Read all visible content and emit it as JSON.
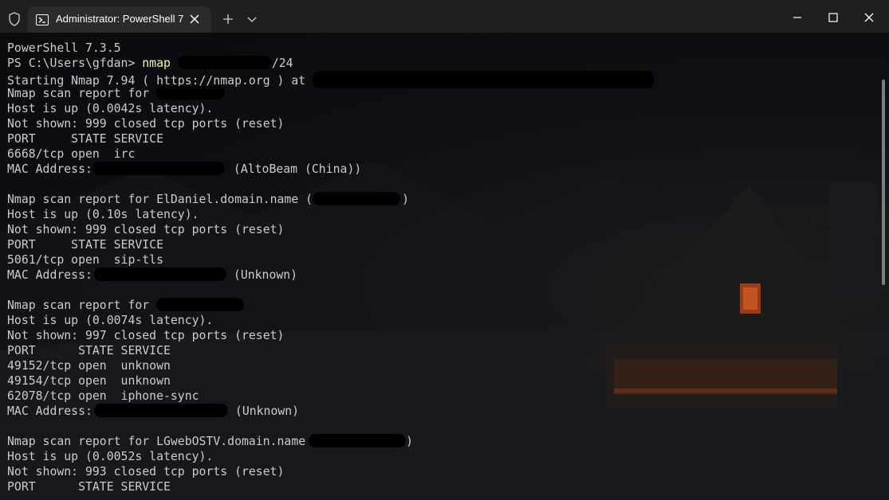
{
  "window": {
    "tab_title": "Administrator: PowerShell 7",
    "colors": {
      "titlebar": "#1f1f1f",
      "tab": "#2b2b2b",
      "text": "#cccccc",
      "command": "#f9f1a5"
    }
  },
  "terminal": {
    "l01": "PowerShell 7.3.5",
    "l02_prompt": "PS C:\\Users\\gfdan> ",
    "l02_cmd": "nmap",
    "l02_suffix": "/24",
    "l03": "Starting Nmap 7.94 ( https://nmap.org ) at",
    "l04": "Nmap scan report for",
    "l05": "Host is up (0.0042s latency).",
    "l06": "Not shown: 999 closed tcp ports (reset)",
    "l07": "PORT     STATE SERVICE",
    "l08": "6668/tcp open  irc",
    "l09a": "MAC Address:",
    "l09b": "(AltoBeam (China))",
    "l11a": "Nmap scan report for ElDaniel.domain.name (",
    "l11b": ")",
    "l12": "Host is up (0.10s latency).",
    "l13": "Not shown: 999 closed tcp ports (reset)",
    "l14": "PORT     STATE SERVICE",
    "l15": "5061/tcp open  sip-tls",
    "l16a": "MAC Address:",
    "l16b": "(Unknown)",
    "l18": "Nmap scan report for",
    "l19": "Host is up (0.0074s latency).",
    "l20": "Not shown: 997 closed tcp ports (reset)",
    "l21": "PORT      STATE SERVICE",
    "l22": "49152/tcp open  unknown",
    "l23": "49154/tcp open  unknown",
    "l24": "62078/tcp open  iphone-sync",
    "l25a": "MAC Address:",
    "l25b": "(Unknown)",
    "l27a": "Nmap scan report for LGwebOSTV.domain.name",
    "l27b": ")",
    "l28": "Host is up (0.0052s latency).",
    "l29": "Not shown: 993 closed tcp ports (reset)",
    "l30": "PORT      STATE SERVICE"
  }
}
